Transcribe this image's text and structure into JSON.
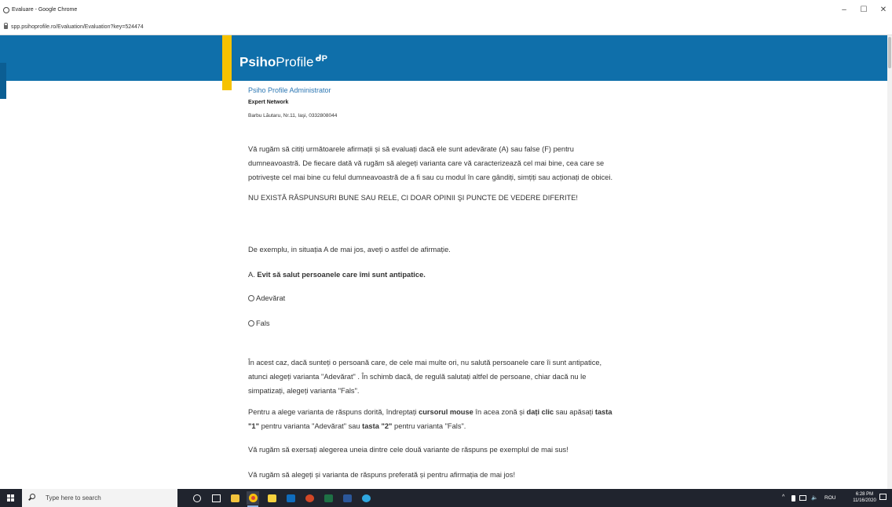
{
  "window": {
    "title": "Evaluare - Google Chrome",
    "minimize": "–",
    "maximize": "☐",
    "close": "✕"
  },
  "browser": {
    "url": "spp.psihoprofile.ro/Evaluation/Evaluation?key=524474"
  },
  "brand": {
    "logo_bold": "Psiho",
    "logo_regular": "Profile",
    "logo_mark": "ᑯP",
    "banner_color": "#0f6faa",
    "accent_color": "#f6c200"
  },
  "header": {
    "admin": "Psiho Profile Administrator",
    "network": "Expert Network",
    "address": "Barbu Lăutaru, Nr.11, Iaşi, 0332808044"
  },
  "content": {
    "intro_1": "Vă rugăm să citiți următoarele afirmații și să evaluați dacă ele sunt adevărate (A) sau false (F) pentru",
    "intro_2": "dumneavoastră. De fiecare dată vă rugăm să alegeți varianta care vă caracterizează cel mai bine, cea care se",
    "intro_3": "potrivește cel mai bine cu felul dumneavoastră de a fi sau cu modul în care gândiți, simțiți sau acționați de obicei.",
    "notice": "NU EXISTĂ RĂSPUNSURI BUNE SAU RELE, CI DOAR OPINII ŞI PUNCTE DE VEDERE DIFERITE!",
    "example_intro": "De exemplu, in situația A de mai jos, aveți o astfel de afirmație.",
    "example_prefix": "A.",
    "example_statement": "Evit să salut persoanele care îmi sunt antipatice.",
    "option_true": "Adevărat",
    "option_false": "Fals",
    "explain_1": "În acest caz, dacă sunteți o persoană care, de cele mai multe ori, nu salută persoanele care îi sunt antipatice,",
    "explain_2": "atunci alegeți varianta \"Adevărat\" . În schimb dacă, de regulă salutați altfel de persoane, chiar dacă nu le",
    "explain_3": "simpatizați, alegeți varianta \"Fals\".",
    "howto_1a": "Pentru a alege varianta de răspuns dorită, îndreptați ",
    "howto_1b": "cursorul mouse",
    "howto_1c": " în acea zonă și ",
    "howto_1d": "dați clic",
    "howto_1e": " sau apăsați ",
    "howto_1f": "tasta",
    "howto_2a": "\"1\"",
    "howto_2b": " pentru varianta \"Adevărat\" sau ",
    "howto_2c": "tasta \"2\"",
    "howto_2d": " pentru varianta \"Fals\".",
    "practice": "Vă rugăm să exersați alegerea uneia dintre cele două variante de răspuns pe exemplul de mai sus!",
    "choose": "Vă rugăm să alegeți și varianta de răspuns preferată și pentru afirmația de mai jos!"
  },
  "taskbar": {
    "search_placeholder": "Type here to search",
    "apps": [
      "cortana-icon",
      "task-view-icon",
      "file-explorer-icon",
      "chrome-icon",
      "sticky-notes-icon",
      "outlook-icon",
      "powerpoint-icon",
      "excel-icon",
      "word-icon",
      "browser-icon"
    ],
    "tray_caret": "^",
    "language": "ROU",
    "time": "6:28 PM",
    "date": "11/16/2020"
  }
}
